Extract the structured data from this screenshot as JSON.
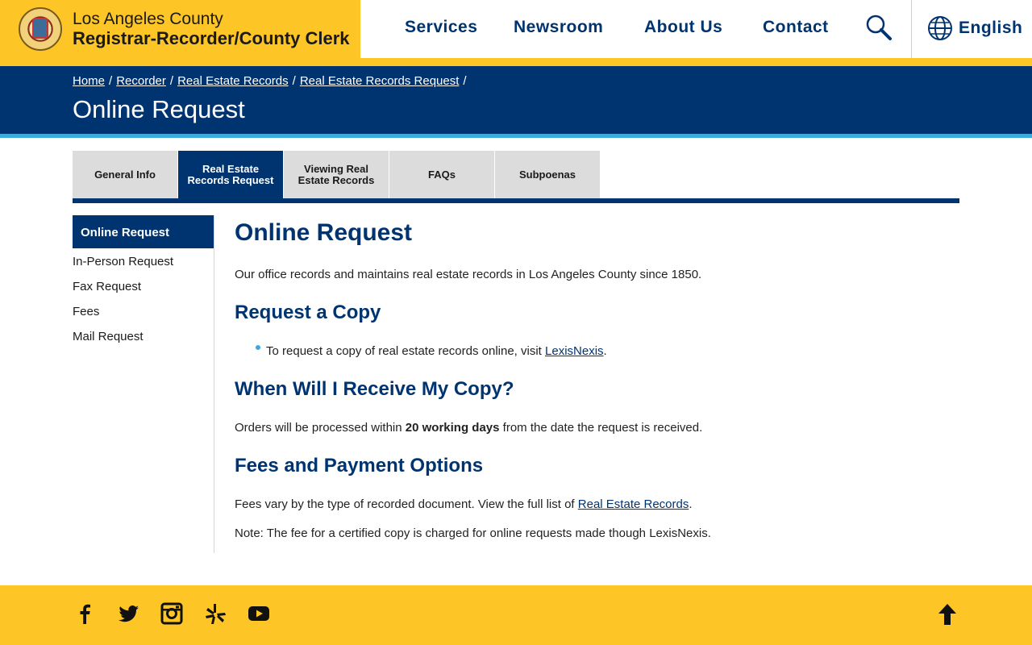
{
  "header": {
    "brand_line1": "Los Angeles County",
    "brand_line2": "Registrar-Recorder/County Clerk",
    "nav": [
      "Services",
      "Newsroom",
      "About Us",
      "Contact"
    ],
    "language": "English",
    "colors": {
      "gold": "#fdc526",
      "navy": "#003470",
      "accent": "#3ca9e0"
    }
  },
  "banner": {
    "breadcrumbs": [
      "Home",
      "Recorder",
      "Real Estate Records",
      "Real Estate Records Request"
    ],
    "sep": "/",
    "title": "Online Request"
  },
  "tabs": [
    {
      "label": "General Info",
      "active": false
    },
    {
      "label": "Real Estate Records Request",
      "active": true
    },
    {
      "label": "Viewing Real Estate Records",
      "active": false
    },
    {
      "label": "FAQs",
      "active": false
    },
    {
      "label": "Subpoenas",
      "active": false
    }
  ],
  "sidebar": {
    "active": "Online Request",
    "items": [
      "In-Person Request",
      "Fax Request",
      "Fees",
      "Mail Request"
    ]
  },
  "content": {
    "title": "Online Request",
    "intro": "Our office records and maintains real estate records in Los Angeles County since 1850.",
    "h_copy": "Request a Copy",
    "copy_text": "To request a copy of real estate records online, visit",
    "copy_link": "LexisNexis",
    "copy_end": ".",
    "h_receive": "When Will I Receive My Copy?",
    "receive_pre": "Orders will be processed within",
    "receive_bold": "20 working days",
    "receive_post": "from the date the request is received.",
    "h_fees": "Fees and Payment Options",
    "fees_text": "Fees vary by the type of recorded document. View the full list of",
    "fees_link": "Real Estate Records",
    "fees_end": ".",
    "note": "Note: The fee for a certified copy is charged for online requests made though LexisNexis."
  },
  "footer": {
    "social_icons": [
      "facebook-icon",
      "twitter-icon",
      "instagram-icon",
      "yelp-icon",
      "youtube-icon"
    ],
    "back_to_top": "arrow-up-icon"
  }
}
